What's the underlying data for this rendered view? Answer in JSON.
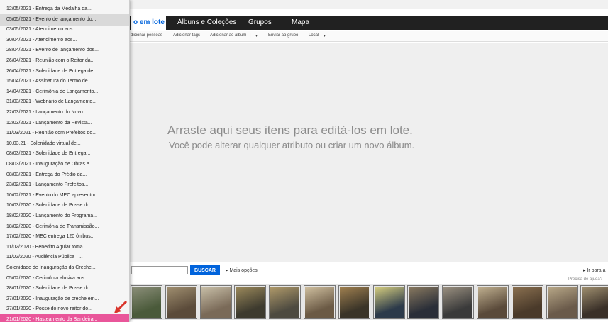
{
  "nav": {
    "tabs": [
      {
        "label": "o em lote",
        "active": true
      },
      {
        "label": "Álbuns e Coleções",
        "active": false
      },
      {
        "label": "Grupos",
        "active": false
      },
      {
        "label": "Mapa",
        "active": false
      }
    ]
  },
  "toolbar": {
    "items": [
      "dicionar pessoas",
      "Adicionar tags",
      "Adicionar ao álbum",
      "|",
      "▾",
      "Enviar ao grupo",
      "Local",
      "▾"
    ]
  },
  "drop_area": {
    "title": "Arraste aqui seus itens para editá-los em lote.",
    "subtitle": "Você pode alterar qualquer atributo ou criar um novo álbum."
  },
  "search": {
    "value": "",
    "button_label": "BUSCAR",
    "more_options": "▸ Mais opções",
    "goto_label": "▸ Ir para a",
    "help_label": "Precisa de ajuda?"
  },
  "dropdown": {
    "items": [
      "12/05/2021 - Entrega da Medalha da...",
      "05/05/2021 - Evento de lançamento do...",
      "03/05/2021 - Atendimento aos...",
      "30/04/2021 - Atendimento aos...",
      "28/04/2021 - Evento de lançamento dos...",
      "26/04/2021 - Reunião com o Reitor da...",
      "26/04/2021 - Solenidade de Entrega de...",
      "15/04/2021 - Assinatura do Termo de...",
      "14/04/2021 - Cerimônia de Lançamento...",
      "31/03/2021 - Webnário de Lançamento...",
      "22/03/2021 - Lançamento do Novo...",
      "12/03/2021 - Lançamento da Revista...",
      "11/03/2021 - Reunião com Prefeitos do...",
      "10.03.21 - Solenidade virtual de...",
      "08/03/2021 - Solenidade de Entrega...",
      "08/03/2021 - Inauguração de Obras e...",
      "08/03/2021 - Entrega do Prédio da...",
      "23/02/2021 - Lançamento Prefeitos...",
      "10/02/2021 - Evento do MEC apresentou...",
      "10/03/2020 - Solenidade de Posse do...",
      "18/02/2020 - Lançamento do Programa...",
      "18/02/2020 - Cerimônia de Transmissão...",
      "17/02/2020 - MEC entrega 120 ônibus...",
      "11/02/2020 - Benedito Aguiar toma...",
      "11/02/2020 - Audiência Pública –...",
      "Solenidade de Inauguração da Creche...",
      "05/02/2020 - Cerimônia alusiva aos...",
      "28/01/2020 - Solenidade de Posse do...",
      "27/01/2020 - Inauguração de creche em...",
      "27/01/2020 - Posse do novo reitor do...",
      "21/01/2020 - Hasteamento da Bandeira..."
    ],
    "highlighted_index": 1,
    "selected_index": 30
  },
  "thumbnails": [
    {
      "colors": [
        "#4a5a3a",
        "#8c8f7a"
      ]
    },
    {
      "colors": [
        "#5b4b3a",
        "#a08f70"
      ]
    },
    {
      "colors": [
        "#7a6a58",
        "#c8bfa8"
      ]
    },
    {
      "colors": [
        "#3d3a2e",
        "#9c8a5c"
      ]
    },
    {
      "colors": [
        "#4d4a40",
        "#b09a6a"
      ]
    },
    {
      "colors": [
        "#6b5a45",
        "#d0c0a0"
      ]
    },
    {
      "colors": [
        "#3a3428",
        "#a08050"
      ]
    },
    {
      "colors": [
        "#2c3a4a",
        "#d8d080"
      ]
    },
    {
      "colors": [
        "#2a2e38",
        "#8a7a60"
      ]
    },
    {
      "colors": [
        "#3a3a3a",
        "#9a9080"
      ]
    },
    {
      "colors": [
        "#5a4a3a",
        "#c0b090"
      ]
    },
    {
      "colors": [
        "#4a3a2a",
        "#8a7050"
      ]
    },
    {
      "colors": [
        "#6a5a4a",
        "#b8a888"
      ]
    },
    {
      "colors": [
        "#3a3028",
        "#a09070"
      ]
    }
  ],
  "colors": {
    "accent": "#0063dc",
    "selected_item": "#e9569a",
    "arrow": "#d9342b"
  }
}
